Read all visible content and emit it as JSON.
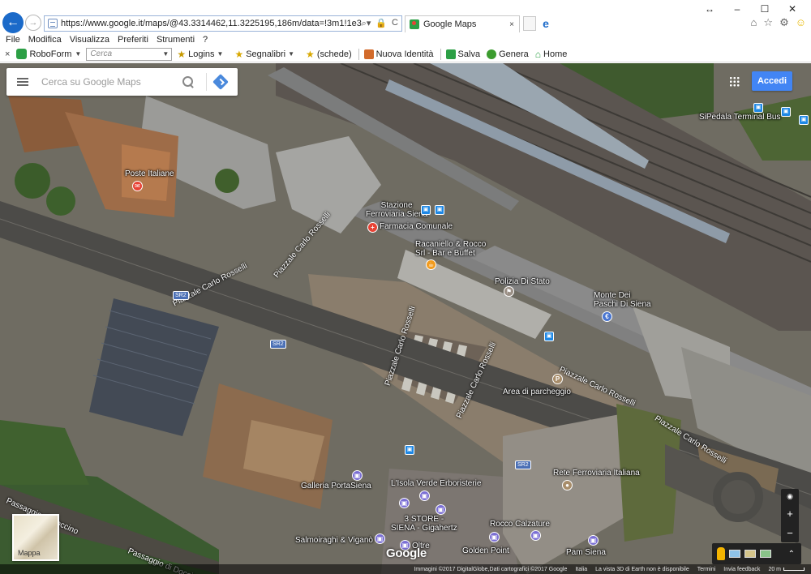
{
  "browser": {
    "url": "https://www.google.it/maps/@43.3314462,11.3225195,186m/data=!3m1!1e3",
    "tab_title": "Google Maps",
    "tab_close": "×",
    "back_glyph": "←",
    "forward_glyph": "→",
    "win_controls": [
      "↔",
      "–",
      "☐",
      "✕"
    ],
    "address_icons": [
      "⌕▾",
      "🔒",
      "C"
    ],
    "right_icons": [
      "⌂",
      "☆",
      "⚙",
      "☺"
    ]
  },
  "menu": {
    "items": [
      "File",
      "Modifica",
      "Visualizza",
      "Preferiti",
      "Strumenti",
      "?"
    ]
  },
  "roboform": {
    "close": "×",
    "name": "RoboForm",
    "search_placeholder": "Cerca",
    "logins": "Logins",
    "bookmarks": "Segnalibri",
    "tabs": "(schede)",
    "new_identity": "Nuova Identità",
    "save": "Salva",
    "generate": "Genera",
    "home": "Home"
  },
  "map": {
    "search_placeholder": "Cerca su Google Maps",
    "signin": "Accedi",
    "minimap_label": "Mappa",
    "google_logo": "Google",
    "zoom_in": "+",
    "zoom_out": "−",
    "expand": "⌃",
    "places": {
      "poste": "Poste Italiane",
      "stazione": "Stazione\nFerroviaria Siena",
      "farmacia": "Farmacia Comunale",
      "racaniello": "Racaniello & Rocco\nSrl - Bar e Buffet",
      "polizia": "Polizia Di Stato",
      "monte": "Monte Dei\nPaschi Di Siena",
      "parcheggio": "Area di parcheggio",
      "rete": "Rete Ferroviaria Italiana",
      "galleria": "Galleria PortaSiena",
      "isola": "L'Isola Verde Erboristerie",
      "store3": "3 STORE -\nSIENA - Gigahertz",
      "salmoiraghi": "Salmoiraghi & Viganò",
      "oltre": "Oltre",
      "rocco": "Rocco Calzature",
      "golden": "Golden Point",
      "pam": "Pam Siena",
      "sipedala": "SiPedala Terminal Bus"
    },
    "roads": {
      "rosselli_1": "Piazzale Carlo Rosselli",
      "rosselli_2": "Piazzale Carlo Rosselli",
      "rosselli_3": "Piazzale Carlo Rosselli",
      "rosselli_4": "Piazzale Carlo Rosselli",
      "rosselli_5": "Piazzale Carlo Rosselli",
      "rosselli_6": "Piazzale Carlo Rosselli",
      "doccino_1": "Passaggio di Doccino",
      "doccino_2": "Passaggio di Doccino",
      "sr2": "SR2"
    },
    "attribution": {
      "imagery": "Immagini ©2017 DigitalGlobe,Dati cartografici ©2017 Google",
      "country": "Italia",
      "earth": "La vista 3D di Earth non è disponibile",
      "terms": "Termini",
      "feedback": "Invia feedback",
      "scale": "20 m"
    }
  }
}
